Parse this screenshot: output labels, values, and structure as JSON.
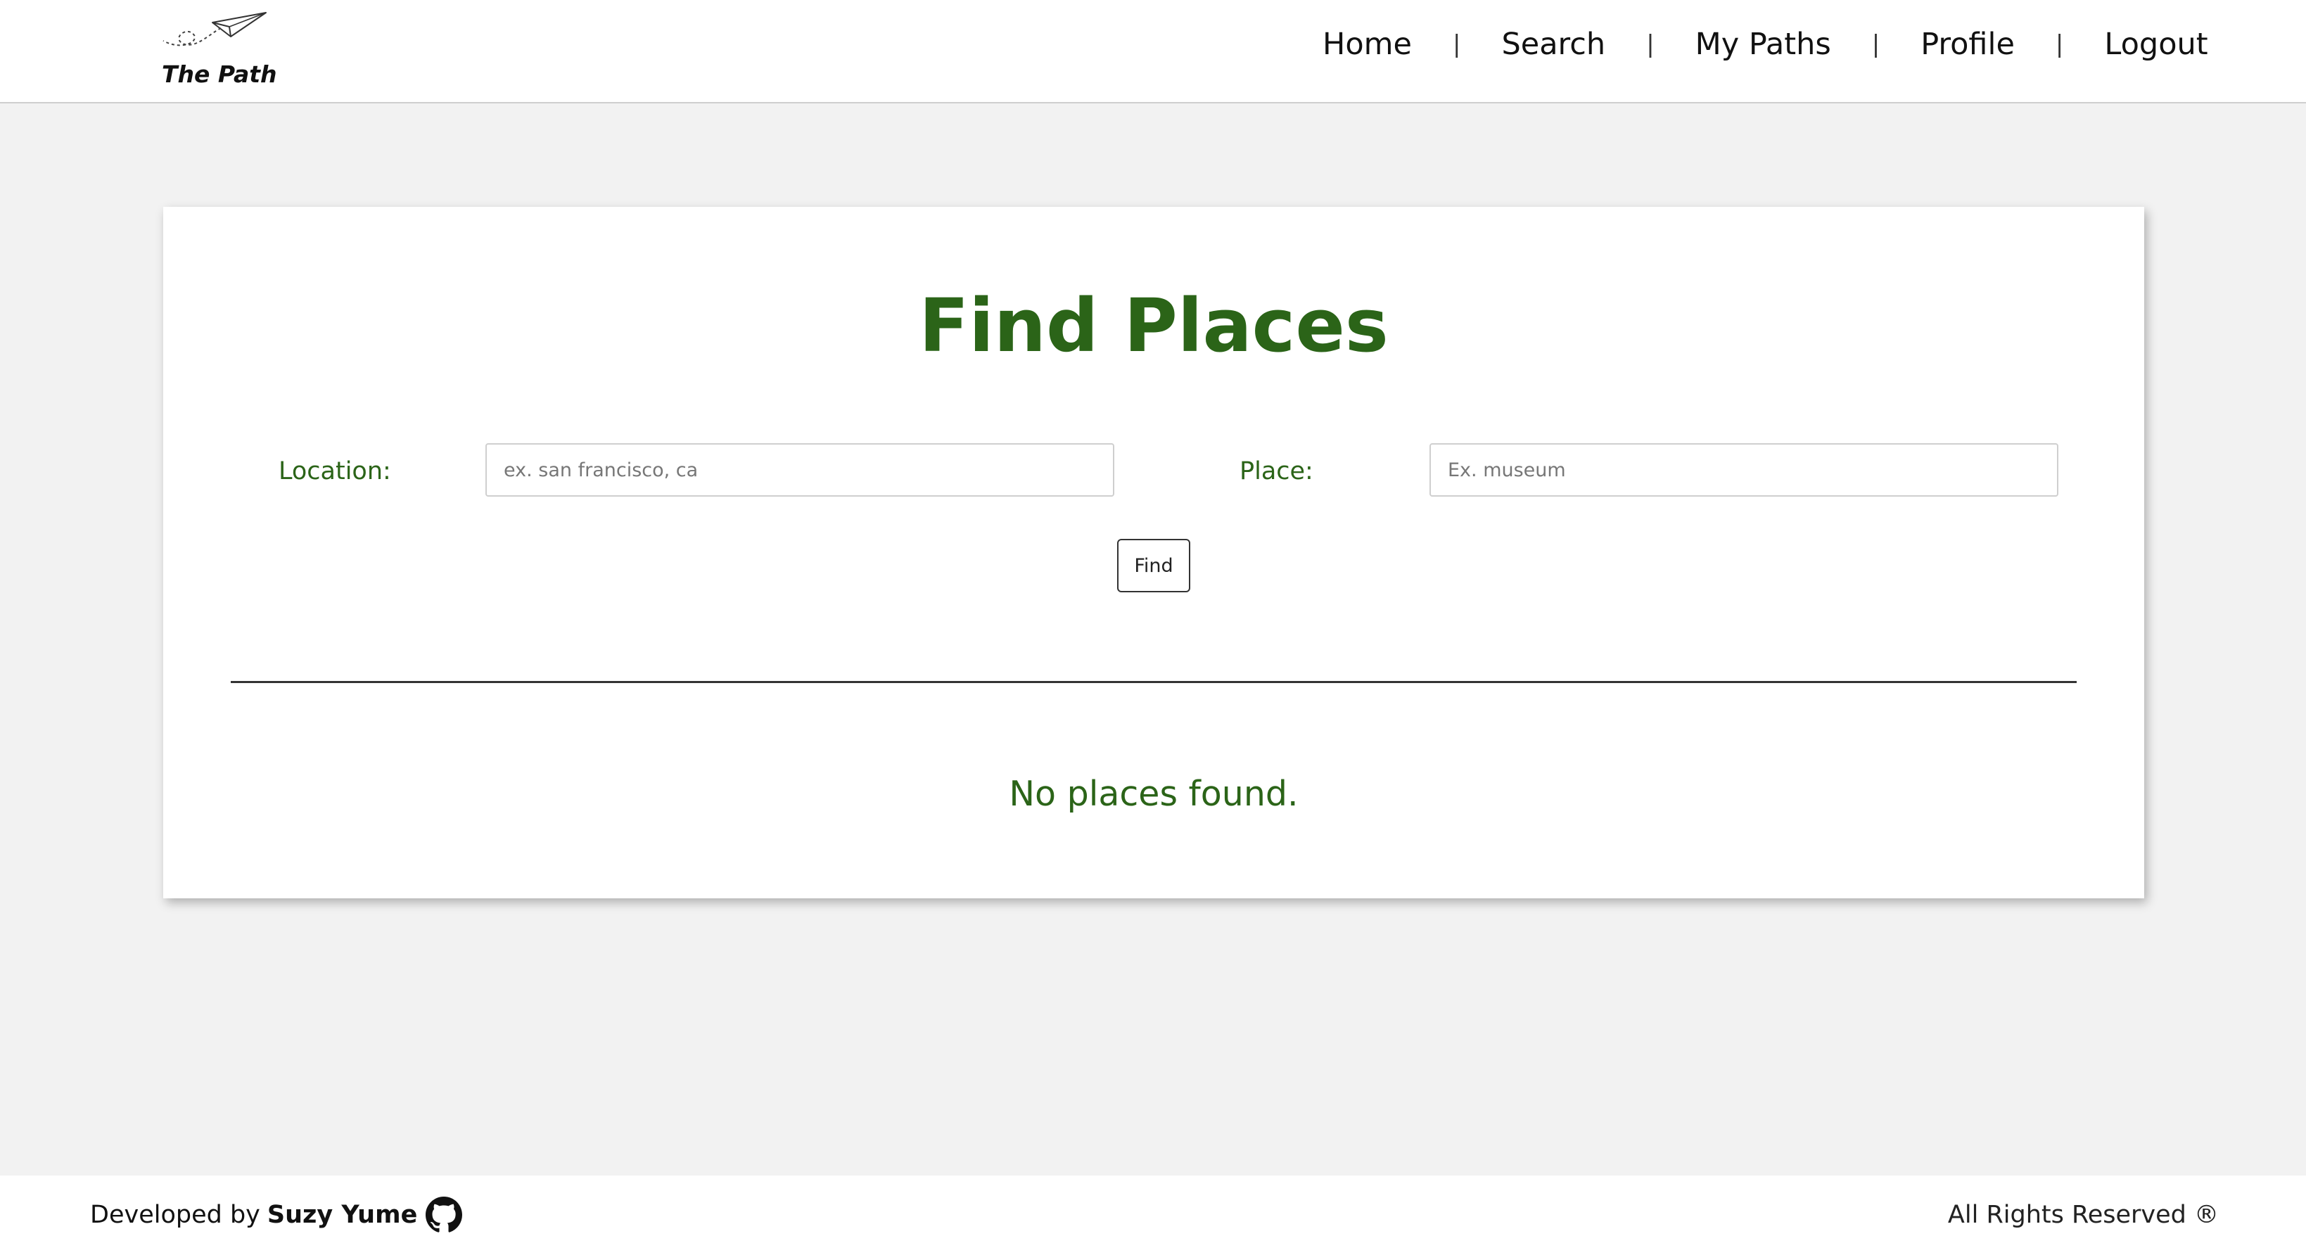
{
  "brand": {
    "name": "The Path",
    "logo_icon": "paper-plane-icon"
  },
  "nav": {
    "items": [
      {
        "label": "Home"
      },
      {
        "label": "Search"
      },
      {
        "label": "My Paths"
      },
      {
        "label": "Profile"
      },
      {
        "label": "Logout"
      }
    ],
    "separator": "|"
  },
  "main": {
    "title": "Find Places",
    "location_label": "Location:",
    "location_placeholder": "ex. san francisco, ca",
    "location_value": "",
    "place_label": "Place:",
    "place_placeholder": "Ex. museum",
    "place_value": "",
    "find_button": "Find",
    "empty_message": "No places found."
  },
  "footer": {
    "developed_by": "Developed by",
    "author": "Suzy Yume",
    "author_icon": "github-icon",
    "rights": "All Rights Reserved ®"
  },
  "colors": {
    "accent_green": "#2b6418",
    "page_background": "#f2f2f2"
  }
}
